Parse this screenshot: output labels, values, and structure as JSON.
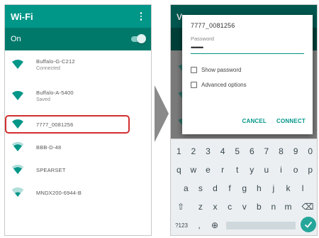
{
  "colors": {
    "accent": "#009688",
    "highlight": "#d32f2f",
    "enter": "#26a69a"
  },
  "left_screen": {
    "title": "Wi-Fi",
    "toggle_label": "On",
    "networks": [
      {
        "ssid": "Buffalo-G-C212",
        "status": "Connected",
        "icon": "wifi-signal-icon"
      },
      {
        "ssid": "Buffalo-A-5400",
        "status": "Saved",
        "icon": "wifi-signal-icon"
      },
      {
        "ssid": "7777_0081256",
        "status": "",
        "icon": "wifi-signal-icon"
      },
      {
        "ssid": "BBB-D-48",
        "status": "",
        "icon": "wifi-signal-icon"
      },
      {
        "ssid": "SPEARSET",
        "status": "",
        "icon": "wifi-signal-icon"
      },
      {
        "ssid": "MNDX200-6944-B",
        "status": "",
        "icon": "wifi-signal-icon"
      }
    ]
  },
  "right_screen": {
    "background_title_fragment": "V",
    "dialog": {
      "title": "7777_0081256",
      "password_label": "Password",
      "password_value": "••••••••",
      "show_password_label": "Show password",
      "advanced_options_label": "Advanced options",
      "cancel_label": "CANCEL",
      "connect_label": "CONNECT"
    },
    "keyboard": {
      "row1": [
        "1",
        "2",
        "3",
        "4",
        "5",
        "6",
        "7",
        "8",
        "9",
        "0"
      ],
      "row2": [
        "q",
        "w",
        "e",
        "r",
        "t",
        "y",
        "u",
        "i",
        "o",
        "p"
      ],
      "row3": [
        "a",
        "s",
        "d",
        "f",
        "g",
        "h",
        "j",
        "k",
        "l"
      ],
      "row4": [
        "z",
        "x",
        "c",
        "v",
        "b",
        "n",
        "m"
      ],
      "shift_glyph": "⇧",
      "backspace_glyph": "⌫",
      "symbols_label": "?123",
      "comma": ",",
      "globe_glyph": "⊕"
    }
  }
}
